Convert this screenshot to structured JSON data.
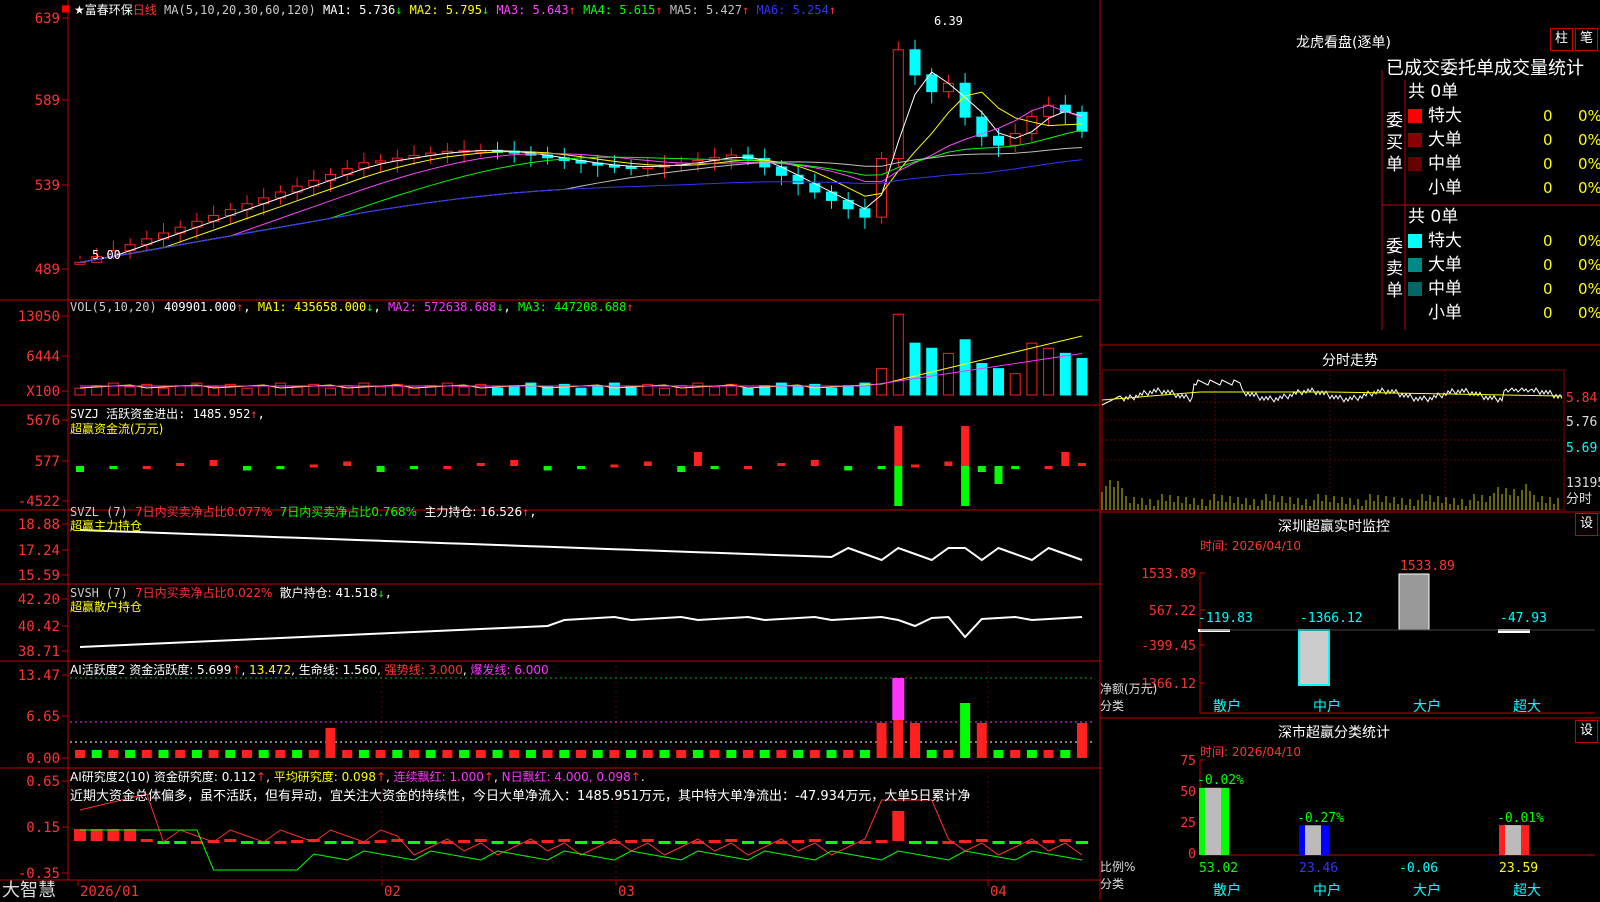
{
  "header": {
    "title": "★富春环保",
    "period": "日线",
    "ma_text": "MA(5,10,20,30,60,120)",
    "ma": [
      {
        "label": "MA1:",
        "value": "5.736",
        "arrow": "↓",
        "color": "#ffffff"
      },
      {
        "label": "MA2:",
        "value": "5.795",
        "arrow": "↓",
        "color": "#ffff00"
      },
      {
        "label": "MA3:",
        "value": "5.643",
        "arrow": "↑",
        "color": "#ff44ff"
      },
      {
        "label": "MA4:",
        "value": "5.615",
        "arrow": "↑",
        "color": "#00ff00"
      },
      {
        "label": "MA5:",
        "value": "5.427",
        "arrow": "↑",
        "color": "#c0c0c0"
      },
      {
        "label": "MA6:",
        "value": "5.254",
        "arrow": "↑",
        "color": "#3333ff"
      }
    ],
    "high_label": "6.39",
    "low_label": "5.00"
  },
  "price_axis": [
    "639",
    "589",
    "539",
    "489"
  ],
  "vol": {
    "label": "VOL(5,10,20)",
    "value": "409901.000",
    "ma1": "MA1: 435658.000",
    "ma2": "MA2: 572638.688",
    "ma3": "MA3: 447208.688",
    "axis": [
      "13050",
      "6444",
      "X100"
    ]
  },
  "svzj": {
    "label": "SVZJ  活跃资金进出: 1485.952",
    "sub": "超赢资金流(万元)",
    "axis": [
      "5676",
      "577",
      "-4522"
    ]
  },
  "svzl": {
    "label": "SVZL (7)",
    "t1": "7日内买卖净占比0.077%",
    "t2": "7日内买卖净占比0.768%",
    "t3": "主力持仓: 16.526",
    "sub": "超赢主力持仓",
    "axis": [
      "18.88",
      "17.24",
      "15.59"
    ]
  },
  "svsh": {
    "label": "SVSH (7)",
    "t1": "7日内买卖净占比0.022%",
    "t2": "散户持仓: 41.518",
    "sub": "超赢散户持仓",
    "axis": [
      "42.20",
      "40.42",
      "38.71"
    ]
  },
  "ai1": {
    "label": "AI活跃度2 资金活跃度: 5.699",
    "t1": "13.472",
    "t2": "生命线: 1.560",
    "t3": "强势线: 3.000",
    "t4": "爆发线: 6.000",
    "axis": [
      "13.47",
      "6.65",
      "0.00"
    ]
  },
  "ai2": {
    "label": "AI研究度2(10) 资金研究度: 0.112",
    "t1": "平均研究度: 0.098",
    "t2": "连续飘红: 1.000",
    "t3": "N日飘红: 4.000, 0.098",
    "note": "近期大资金总体偏多，虽不活跃，但有异动，宜关注大资金的持续性，今日大单净流入：1485.951万元，其中特大单净流出：-47.934万元，大单5日累计净",
    "axis": [
      "0.65",
      "0.15",
      "-0.35"
    ]
  },
  "date_axis": [
    "2026/01",
    "02",
    "03",
    "04"
  ],
  "footer_logo": "大智慧",
  "right": {
    "lhb_title": "龙虎看盘(逐单)",
    "btn_zhu": "柱",
    "btn_bi": "笔",
    "table_title": "已成交委托单成交量统计",
    "buy_label": "委买单",
    "sell_label": "委卖单",
    "buy_total": "共 0单",
    "sell_total": "共 0单",
    "buy_rows": [
      {
        "name": "特大",
        "qty": "0",
        "pct": "0%",
        "color": "#ff0000"
      },
      {
        "name": "大单",
        "qty": "0",
        "pct": "0%",
        "color": "#880000"
      },
      {
        "name": "中单",
        "qty": "0",
        "pct": "0%",
        "color": "#660000"
      },
      {
        "name": "小单",
        "qty": "0",
        "pct": "0%",
        "color": ""
      }
    ],
    "sell_rows": [
      {
        "name": "特大",
        "qty": "0",
        "pct": "0%",
        "color": "#00ffff"
      },
      {
        "name": "大单",
        "qty": "0",
        "pct": "0%",
        "color": "#008888"
      },
      {
        "name": "中单",
        "qty": "0",
        "pct": "0%",
        "color": "#006666"
      },
      {
        "name": "小单",
        "qty": "0",
        "pct": "0%",
        "color": ""
      }
    ],
    "intraday_title": "分时走势",
    "intraday_axis": [
      "5.84",
      "5.76",
      "5.69",
      "13195",
      "分时"
    ],
    "sz_title": "深圳超赢实时监控",
    "sz_btn": "设",
    "sz_time": "时间: 2026/04/10",
    "sz_axis": [
      "1533.89",
      "567.22",
      "-399.45",
      "-1366.12"
    ],
    "sz_unit": "净额(万元)",
    "sz_cat_label": "分类",
    "sz_cats": [
      "散户",
      "中户",
      "大户",
      "超大"
    ],
    "sz_values": [
      "-119.83",
      "-1366.12",
      "1533.89",
      "-47.93"
    ],
    "cls_title": "深市超赢分类统计",
    "cls_btn": "设",
    "cls_time": "时间: 2026/04/10",
    "cls_axis": [
      "75",
      "50",
      "25",
      "0"
    ],
    "cls_unit": "比例%",
    "cls_cat_label": "分类",
    "cls_cats": [
      "散户",
      "中户",
      "大户",
      "超大"
    ],
    "cls_top": [
      "-0.02%",
      "-0.27%",
      "",
      "-0.01%"
    ],
    "cls_bottom": [
      "53.02",
      "23.46",
      "-0.06",
      "23.59"
    ]
  },
  "chart_data": [
    {
      "type": "candlestick",
      "title": "富春环保 日线",
      "ylim": [
        4.89,
        6.39
      ],
      "high": 6.39,
      "low": 5.0
    },
    {
      "type": "bar",
      "title": "深圳超赢实时监控",
      "categories": [
        "散户",
        "中户",
        "大户",
        "超大"
      ],
      "values": [
        -119.83,
        -1366.12,
        1533.89,
        -47.93
      ],
      "ylabel": "净额(万元)"
    },
    {
      "type": "bar",
      "title": "深市超赢分类统计",
      "categories": [
        "散户",
        "中户",
        "大户",
        "超大"
      ],
      "values": [
        53.02,
        23.46,
        -0.06,
        23.59
      ],
      "ylim": [
        0,
        75
      ],
      "ylabel": "比例%"
    }
  ],
  "colors": {
    "up": "#ff2020",
    "down": "#00ffff",
    "grid": "#c00000",
    "text_yellow": "#ffff00",
    "text_red": "#ff3030",
    "green": "#00ff00",
    "magenta": "#ff33ff"
  }
}
